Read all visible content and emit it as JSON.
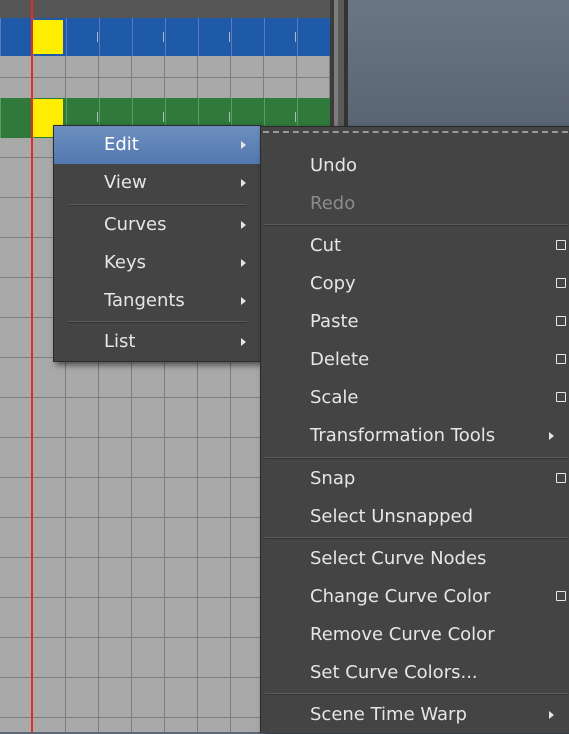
{
  "main_menu": {
    "items": [
      {
        "label": "Edit",
        "submenu": true,
        "highlighted": true
      },
      {
        "label": "View",
        "submenu": true
      },
      {
        "label": "Curves",
        "submenu": true
      },
      {
        "label": "Keys",
        "submenu": true
      },
      {
        "label": "Tangents",
        "submenu": true
      },
      {
        "label": "List",
        "submenu": true
      }
    ]
  },
  "edit_submenu": {
    "items": [
      {
        "label": "Undo"
      },
      {
        "label": "Redo",
        "disabled": true
      },
      {
        "label": "Cut",
        "option_box": true
      },
      {
        "label": "Copy",
        "option_box": true
      },
      {
        "label": "Paste",
        "option_box": true
      },
      {
        "label": "Delete",
        "option_box": true
      },
      {
        "label": "Scale",
        "option_box": true
      },
      {
        "label": "Transformation Tools",
        "submenu": true
      },
      {
        "label": "Snap",
        "option_box": true
      },
      {
        "label": "Select Unsnapped"
      },
      {
        "label": "Select Curve Nodes"
      },
      {
        "label": "Change Curve Color",
        "option_box": true
      },
      {
        "label": "Remove Curve Color"
      },
      {
        "label": "Set Curve Colors..."
      },
      {
        "label": "Scene Time Warp",
        "submenu": true
      }
    ]
  },
  "colors": {
    "menu_bg": "#444444",
    "highlight": "#5f85bb",
    "track_blue": "#1f5aa8",
    "track_green": "#2f7a3a",
    "key_yellow": "#ffee00",
    "time_cursor": "#e82a2a"
  }
}
